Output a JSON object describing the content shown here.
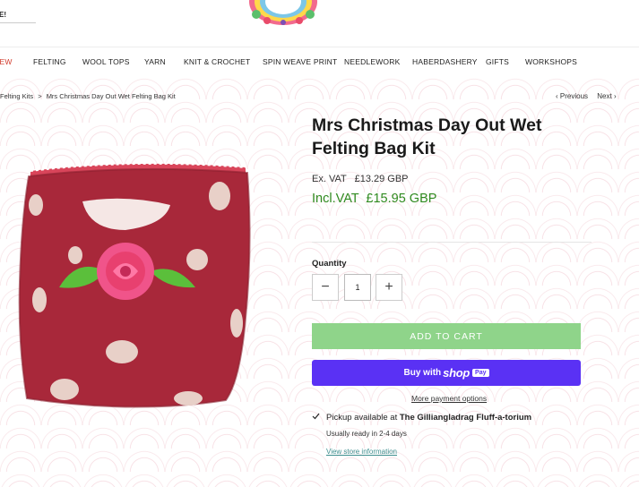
{
  "header": {
    "partial_text": "E!"
  },
  "nav": {
    "items": [
      {
        "label": "IEW"
      },
      {
        "label": "FELTING"
      },
      {
        "label": "WOOL TOPS"
      },
      {
        "label": "YARN"
      },
      {
        "label": "KNIT & CROCHET"
      },
      {
        "label": "SPIN WEAVE PRINT"
      },
      {
        "label": "NEEDLEWORK"
      },
      {
        "label": "HABERDASHERY"
      },
      {
        "label": "GIFTS"
      },
      {
        "label": "WORKSHOPS"
      }
    ]
  },
  "breadcrumb": {
    "parent": "Felting Kits",
    "separator": ">",
    "current": "Mrs Christmas Day Out Wet Felting Bag Kit"
  },
  "pager": {
    "prev": "Previous",
    "next": "Next",
    "prev_icon": "chevron-left-icon",
    "next_icon": "chevron-right-icon"
  },
  "product": {
    "title": "Mrs Christmas Day Out Wet Felting Bag Kit",
    "price_ex_label": "Ex. VAT",
    "price_ex_value": "£13.29 GBP",
    "price_inc_label": "Incl.VAT",
    "price_inc_value": "£15.95 GBP",
    "quantity_label": "Quantity",
    "quantity_value": "1",
    "minus": "−",
    "plus": "+",
    "add_to_cart": "ADD TO CART",
    "buy_with": "Buy with",
    "shop": "shop",
    "pay": "Pay",
    "more_payment": "More payment options",
    "pickup_prefix": "Pickup available at",
    "pickup_location": "The Gilliangladrag Fluff-a-torium",
    "ready_text": "Usually ready in 2-4 days",
    "store_info": "View store information"
  },
  "colors": {
    "accent_green": "#2f8a1f",
    "cart_button": "#8fd48a",
    "shop_pay": "#5a31f4",
    "nav_new": "#d23b2c",
    "link_teal": "#3f8f8f"
  }
}
